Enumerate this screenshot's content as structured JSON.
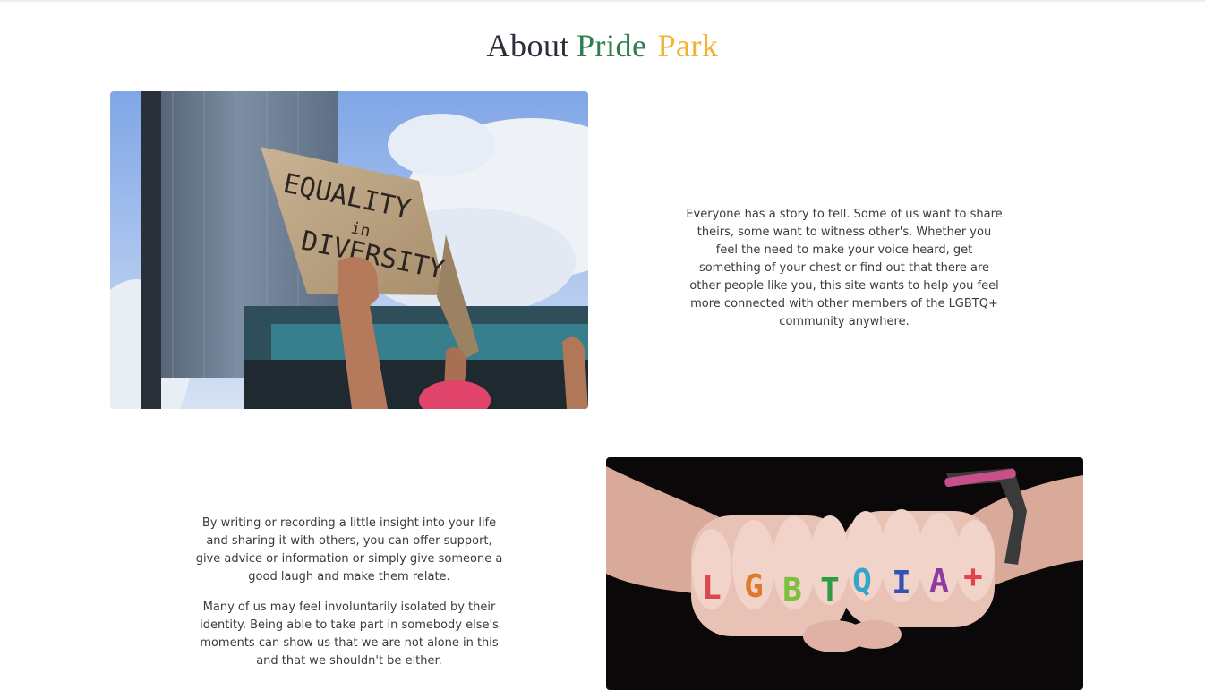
{
  "about": {
    "title_word1": "About",
    "title_word2": "Pride",
    "title_word3": "Park",
    "colors": {
      "title_dark": "#2b2f3a",
      "pride_green": "#2e7d4f",
      "park_yellow": "#f2b233"
    }
  },
  "section1": {
    "image": {
      "sign_line1": "EQUALITY",
      "sign_line2": "in",
      "sign_line3": "DIVERSITY"
    },
    "paragraph": "Everyone has a story to tell. Some of us want to share theirs, some want to witness other's. Whether you feel the need to make your voice heard, get something of your chest or find out that there are other people like you, this site wants to help you feel more connected with other members of the LGBTQ+ community anywhere."
  },
  "section2": {
    "paragraph1": "By writing or recording a little insight into your life and sharing it with others, you can offer support, give advice or information or simply give someone a good laugh and make them relate.",
    "paragraph2": "Many of us may feel involuntarily isolated by their identity. Being able to take part in somebody else's moments can show us that we are not alone in this and that we shouldn't be either.",
    "image": {
      "knuckle_letters": [
        "L",
        "G",
        "B",
        "T",
        "Q",
        "I",
        "A",
        "+"
      ],
      "letter_colors": [
        "#d9484f",
        "#e07a2a",
        "#7cc041",
        "#2e9b45",
        "#2fa7c9",
        "#3553b5",
        "#8e3aa3",
        "#e0434a"
      ]
    }
  }
}
